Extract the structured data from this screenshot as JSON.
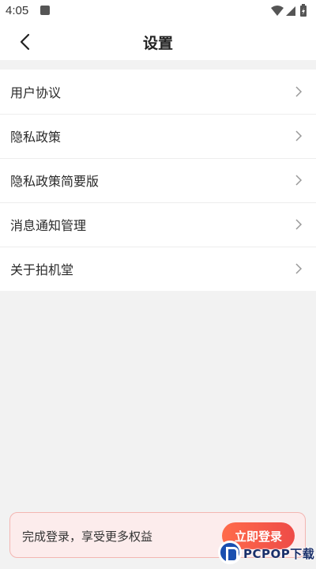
{
  "status_bar": {
    "time": "4:05",
    "app_icon": "android-notification-icon",
    "icons": [
      "wifi-icon",
      "signal-icon",
      "battery-icon"
    ]
  },
  "header": {
    "back_icon": "chevron-left-icon",
    "title": "设置"
  },
  "menu": {
    "items": [
      {
        "label": "用户协议"
      },
      {
        "label": "隐私政策"
      },
      {
        "label": "隐私政策简要版"
      },
      {
        "label": "消息通知管理"
      },
      {
        "label": "关于拍机堂"
      }
    ]
  },
  "banner": {
    "text": "完成登录，享受更多权益",
    "button_label": "立即登录",
    "accent_color": "#ee4b48"
  },
  "watermark": {
    "text": "PCPOP下载"
  }
}
